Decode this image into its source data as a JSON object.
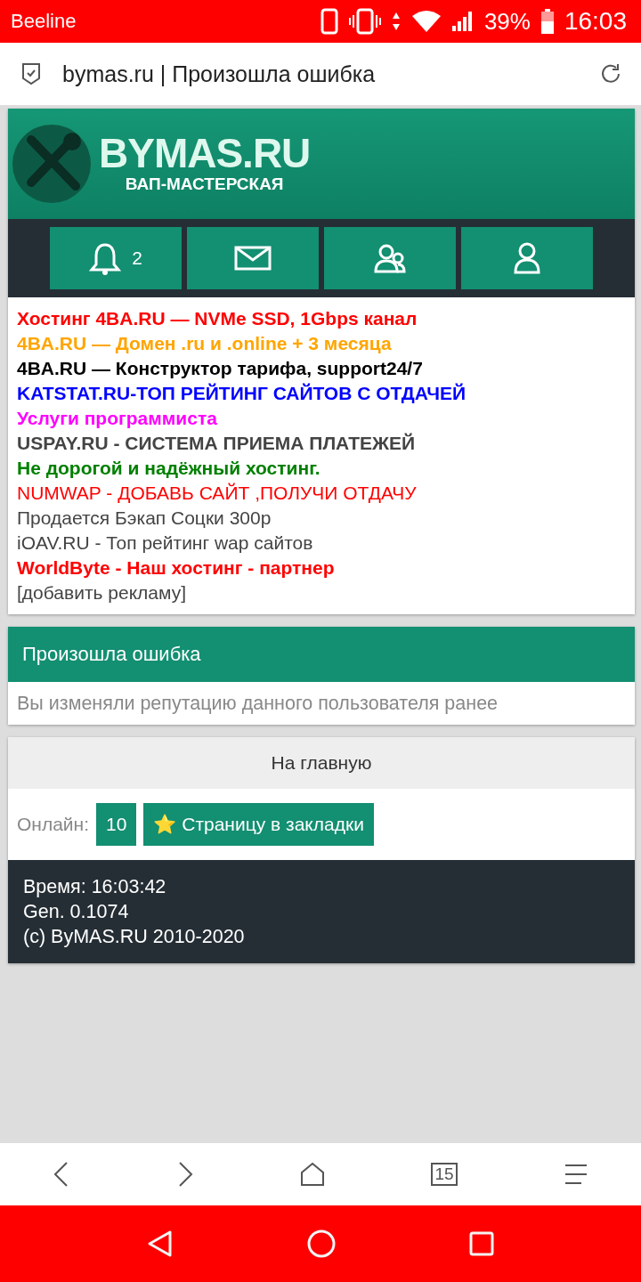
{
  "status_bar": {
    "carrier": "Beeline",
    "battery": "39%",
    "time": "16:03"
  },
  "address_bar": {
    "title": "bymas.ru | Произошла ошибка"
  },
  "logo": {
    "title": "BYMAS.RU",
    "subtitle": "ВАП-МАСТЕРСКАЯ"
  },
  "nav_buttons": [
    {
      "kind": "bell",
      "count": "2"
    },
    {
      "kind": "mail"
    },
    {
      "kind": "friends"
    },
    {
      "kind": "profile"
    }
  ],
  "ads": [
    {
      "text": "Хостинг 4BA.RU — NVMe SSD, 1Gbps канал",
      "color": "#ff0000",
      "bold": true
    },
    {
      "text": "4BA.RU — Домен .ru и .online + 3 месяца",
      "color": "#ffa500",
      "bold": true
    },
    {
      "text": "4BA.RU — Конструктор тарифа, support24/7",
      "color": "#000000",
      "bold": true
    },
    {
      "text": "KATSTAT.RU-ТОП РЕЙТИНГ САЙТОВ С ОТДАЧЕЙ",
      "color": "#0000ff",
      "bold": true
    },
    {
      "text": "Услуги программиста",
      "color": "#ff00ff",
      "bold": true
    },
    {
      "text": "USPAY.RU - СИСТЕМА ПРИЕМА ПЛАТЕЖЕЙ",
      "color": "#444444",
      "bold": true
    },
    {
      "text": "Не дорогой и надёжный хостинг.",
      "color": "#008000",
      "bold": true
    },
    {
      "text": "NUMWAP - ДОБАВЬ САЙТ ,ПОЛУЧИ ОТДАЧУ",
      "color": "#ff0000",
      "bold": false
    },
    {
      "text": "Продается Бэкап Соцки 300р",
      "color": "#444444",
      "bold": false
    },
    {
      "text": "iOAV.RU - Топ рейтинг wap сайтов",
      "color": "#444444",
      "bold": false
    },
    {
      "text": "WorldByte - Наш хостинг - партнер",
      "color": "#ff0000",
      "bold": true
    },
    {
      "text": "[добавить рекламу]",
      "color": "#444444",
      "bold": false
    }
  ],
  "error": {
    "title": "Произошла ошибка",
    "message": "Вы изменяли репутацию данного пользователя ранее"
  },
  "home_link": "На главную",
  "online": {
    "label": "Онлайн:",
    "count": "10",
    "bookmark": "⭐ Страницу в закладки"
  },
  "footer": [
    "Время: 16:03:42",
    "Gen. 0.1074",
    "(c) ByMAS.RU 2010-2020"
  ],
  "browser_bar": {
    "tabs_count": "15"
  }
}
